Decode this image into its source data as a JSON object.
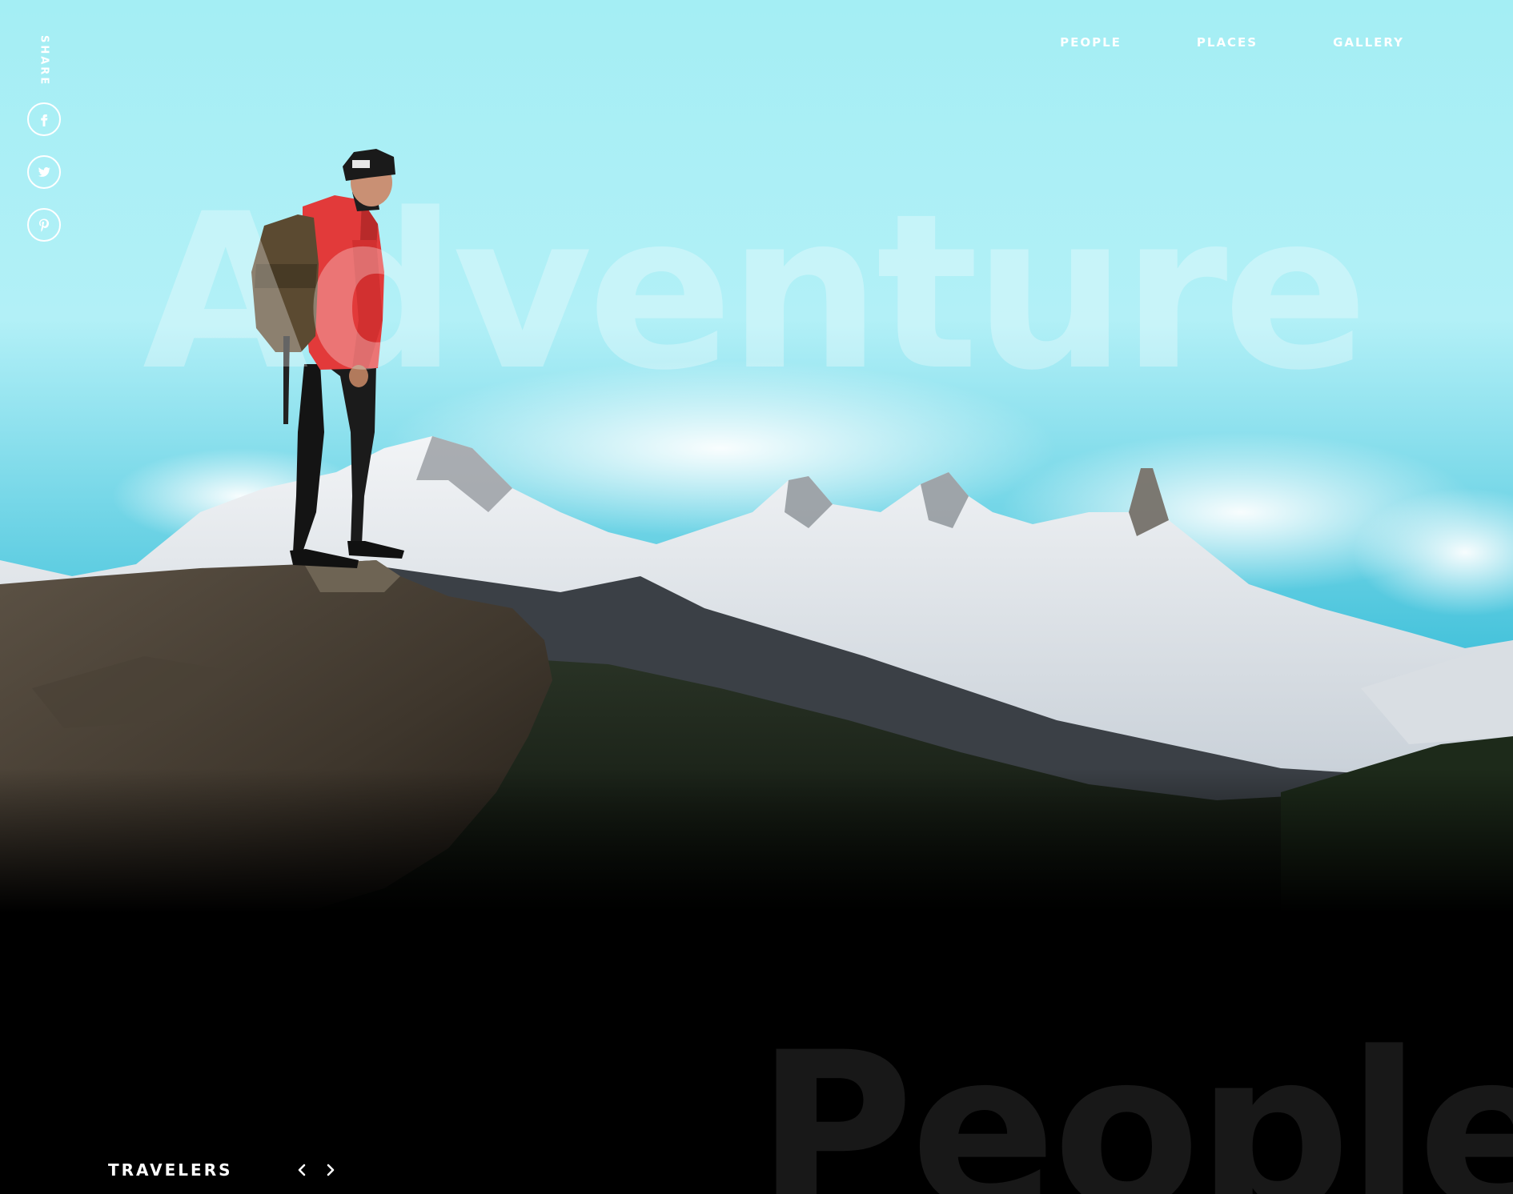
{
  "hero": {
    "title": "Adventure",
    "image": "hiker-on-rock-mountain-landscape"
  },
  "share": {
    "label": "SHARE",
    "buttons": [
      {
        "icon": "facebook-icon"
      },
      {
        "icon": "twitter-icon"
      },
      {
        "icon": "pinterest-icon"
      }
    ]
  },
  "nav": {
    "items": [
      {
        "label": "PEOPLE"
      },
      {
        "label": "PLACES"
      },
      {
        "label": "GALLERY"
      }
    ]
  },
  "section": {
    "title": "People",
    "label": "TRAVELERS",
    "prev_icon": "chevron-left-icon",
    "next_icon": "chevron-right-icon"
  },
  "colors": {
    "sky_top": "#8fe6f0",
    "sky_bottom": "#3fbcd8",
    "jacket": "#e23a3a",
    "background": "#000000"
  }
}
